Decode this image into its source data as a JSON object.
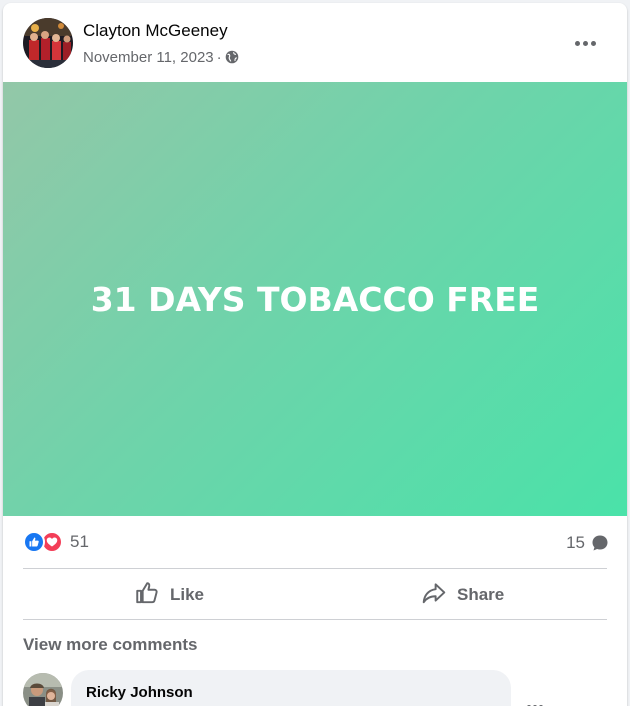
{
  "post": {
    "author": "Clayton McGeeney",
    "date": "November 11, 2023",
    "separator": "·",
    "privacy_icon": "globe-icon",
    "more_icon": "more-options-icon",
    "banner_text": "31 DAYS TOBACCO FREE",
    "banner_colors": [
      "#93c7a8",
      "#4ae2a9"
    ]
  },
  "stats": {
    "reaction_icons": [
      "like-reaction-icon",
      "love-reaction-icon"
    ],
    "reaction_count": "51",
    "comment_count": "15",
    "comment_icon": "comment-bubble-icon"
  },
  "actions": {
    "like_label": "Like",
    "share_label": "Share"
  },
  "comments": {
    "view_more_label": "View more comments",
    "items": [
      {
        "author": "Ricky Johnson"
      }
    ]
  },
  "colors": {
    "accent_like": "#1877f2",
    "accent_love": "#f33e58",
    "secondary_text": "#65676b"
  }
}
